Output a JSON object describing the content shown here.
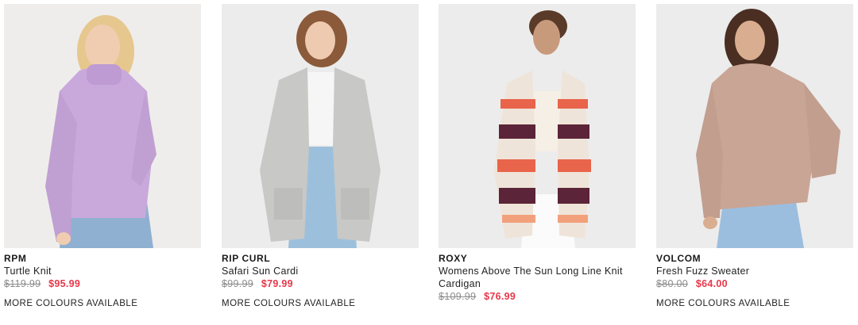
{
  "products": [
    {
      "brand": "RPM",
      "name": "Turtle Knit",
      "was_price": "$119.99",
      "now_price": "$95.99",
      "note": "MORE COLOURS AVAILABLE",
      "garment_color": "#c9a8dc"
    },
    {
      "brand": "RIP CURL",
      "name": "Safari Sun Cardi",
      "was_price": "$99.99",
      "now_price": "$79.99",
      "note": "MORE COLOURS AVAILABLE",
      "garment_color": "#c8c8c6"
    },
    {
      "brand": "ROXY",
      "name": "Womens Above The Sun Long Line Knit Cardigan",
      "was_price": "$109.99",
      "now_price": "$76.99",
      "note": "",
      "garment_color": "#efe4d9"
    },
    {
      "brand": "VOLCOM",
      "name": "Fresh Fuzz Sweater",
      "was_price": "$80.00",
      "now_price": "$64.00",
      "note": "MORE COLOURS AVAILABLE",
      "garment_color": "#c9a595"
    }
  ],
  "colors": {
    "sale_price": "#e8374a",
    "was_price": "#8c8c8c",
    "photo_bg": "#ebebeb"
  }
}
